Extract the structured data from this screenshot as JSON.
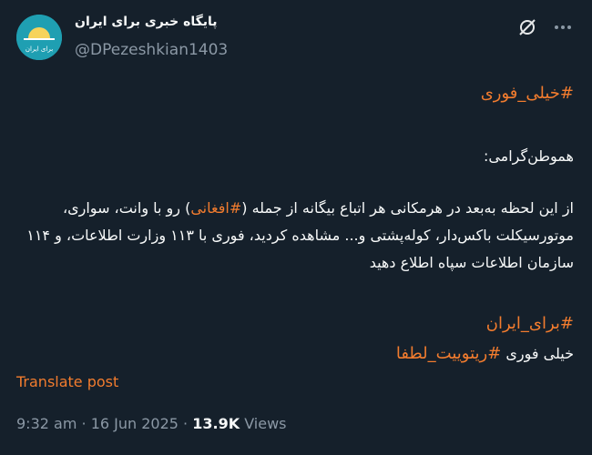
{
  "author": {
    "display_name": "پایگاه خبری برای ایران",
    "handle": "@DPezeshkian1403",
    "avatar_text": "برای ایران"
  },
  "tweet": {
    "hashtag_top": "#خیلی_فوری",
    "greeting": "هموطن‌گرامی:",
    "para_part1": "از این لحظه به‌بعد در هرمکانی هر اتباع بیگانه از جمله (",
    "para_hashtag": "#افغانی",
    "para_part2": ") رو با وانت، سواری، موتورسیکلت باکس‌دار، کوله‌پشتی و... مشاهده کردید، فوری با ۱۱۳ وزارت اطلاعات، و ۱۱۴ سازمان اطلاعات سپاه اطلاع دهید",
    "hashtag_bottom": "#برای_ایران",
    "closing_text": "خیلی فوری ",
    "closing_hashtag": "#ریتوییت_لطفا"
  },
  "translate_label": "Translate post",
  "meta": {
    "time": "9:32 am",
    "separator": "·",
    "date": "16 Jun 2025",
    "views_count": "13.9K",
    "views_label": "Views"
  },
  "icons": {
    "grok": "slash-circle-icon",
    "more": "more-dots-icon"
  },
  "colors": {
    "background": "#15202b",
    "accent": "#f27c2e",
    "text": "#f7f9f9",
    "secondary": "#8b98a5"
  }
}
